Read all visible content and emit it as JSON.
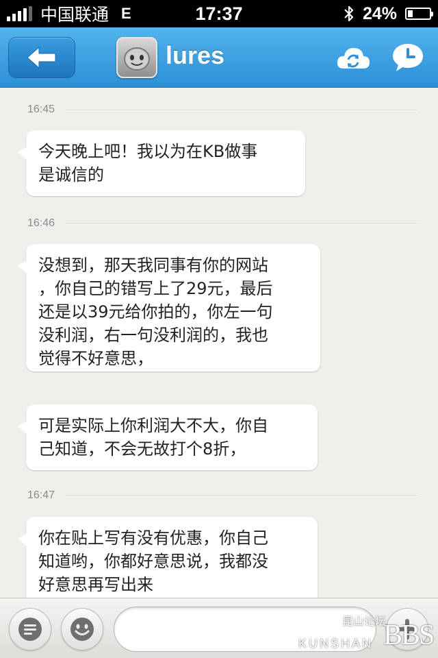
{
  "status_bar": {
    "carrier": "中国联通",
    "network": "E",
    "time": "17:37",
    "battery": "24%",
    "battery_level": 0.24,
    "icons": [
      "signal-icon",
      "bluetooth-icon",
      "battery-icon"
    ]
  },
  "nav": {
    "back_icon": "arrow-left-icon",
    "contact_name": "lures",
    "avatar_icon": "smiley-avatar-icon",
    "refresh_icon": "cloud-sync-icon",
    "history_icon": "clock-bubble-icon",
    "accent_color": "#3a9ddf"
  },
  "chat": {
    "timestamps": [
      "16:45",
      "16:46",
      "16:47"
    ],
    "messages": [
      "今天晚上吧！我以为在KB做事\n是诚信的",
      "没想到，那天我同事有你的网站\n，你自己的错写上了29元，最后\n还是以39元给你拍的，你左一句\n没利润，右一句没利润的，我也\n觉得不好意思，",
      "可是实际上你利润大不大，你自\n己知道，不会无故打个8折，",
      "你在贴上写有没有优惠，你自己\n知道哟，你都好意思说，我都没\n好意思再写出来"
    ]
  },
  "toolbar": {
    "menu_icon": "speech-lines-icon",
    "emoji_icon": "smiley-icon",
    "plus_icon": "plus-icon",
    "input_placeholder": "",
    "watermark_cn": "昆山论坛",
    "watermark_en": "KUNSHAN",
    "watermark_bbs": "BBS"
  }
}
